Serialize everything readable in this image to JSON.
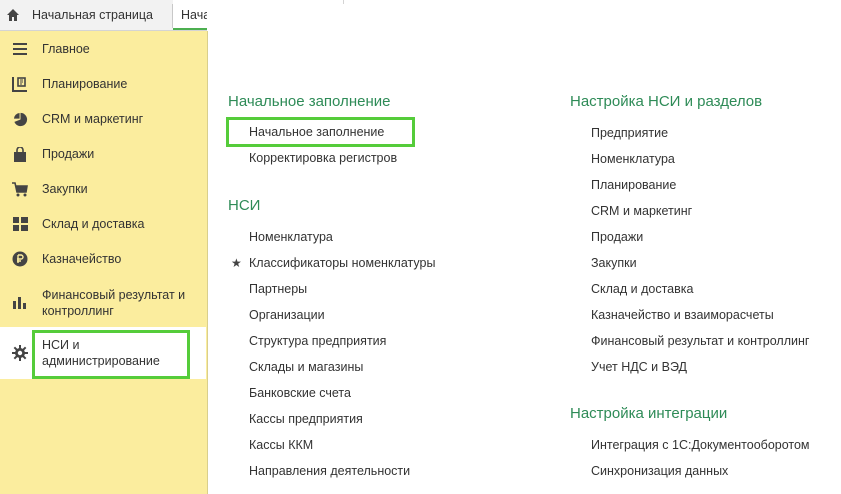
{
  "tabs": {
    "home_label": "Начальная страница",
    "active_label": "Начальное заполнение"
  },
  "sidebar": {
    "items": [
      {
        "label": "Главное",
        "icon": "menu-lines-icon"
      },
      {
        "label": "Планирование",
        "icon": "planning-icon"
      },
      {
        "label": "CRM и маркетинг",
        "icon": "pie-chart-icon"
      },
      {
        "label": "Продажи",
        "icon": "shopping-bag-icon"
      },
      {
        "label": "Закупки",
        "icon": "cart-icon"
      },
      {
        "label": "Склад и доставка",
        "icon": "warehouse-grid-icon"
      },
      {
        "label": "Казначейство",
        "icon": "ruble-coin-icon"
      },
      {
        "label": "Финансовый результат и контроллинг",
        "icon": "bar-chart-icon"
      },
      {
        "label": "НСИ и администрирование",
        "icon": "gear-icon",
        "active": true
      }
    ]
  },
  "left_column": {
    "initial_fill": {
      "heading": "Начальное заполнение",
      "items": [
        "Начальное заполнение",
        "Корректировка регистров"
      ]
    },
    "nsi": {
      "heading": "НСИ",
      "items": [
        "Номенклатура",
        "Классификаторы номенклатуры",
        "Партнеры",
        "Организации",
        "Структура предприятия",
        "Склады и магазины",
        "Банковские счета",
        "Кассы предприятия",
        "Кассы ККМ",
        "Направления деятельности"
      ],
      "starred_index": 1
    }
  },
  "right_column": {
    "settings": {
      "heading": "Настройка НСИ и разделов",
      "items": [
        "Предприятие",
        "Номенклатура",
        "Планирование",
        "CRM и маркетинг",
        "Продажи",
        "Закупки",
        "Склад и доставка",
        "Казначейство и взаиморасчеты",
        "Финансовый результат и контроллинг",
        "Учет НДС и ВЭД"
      ]
    },
    "integration": {
      "heading": "Настройка интеграции",
      "items": [
        "Интеграция с 1С:Документооборотом",
        "Синхронизация данных"
      ]
    }
  },
  "colors": {
    "sidebar_bg": "#fbed9e",
    "section_heading": "#2e8b57",
    "highlight_border": "#55cc3a"
  }
}
